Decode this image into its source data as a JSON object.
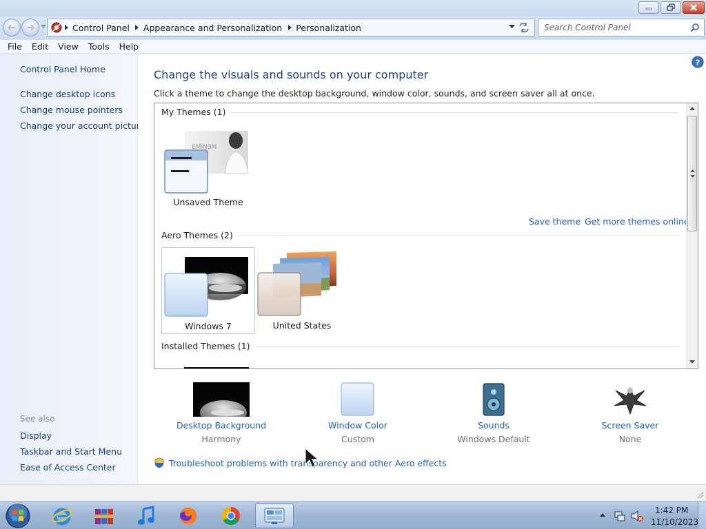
{
  "address": {
    "crumbs": [
      "Control Panel",
      "Appearance and Personalization",
      "Personalization"
    ]
  },
  "search": {
    "placeholder": "Search Control Panel"
  },
  "menu": [
    "File",
    "Edit",
    "View",
    "Tools",
    "Help"
  ],
  "sidebar": {
    "home": "Control Panel Home",
    "links": [
      "Change desktop icons",
      "Change mouse pointers",
      "Change your account picture"
    ],
    "see_also_title": "See also",
    "see_also": [
      "Display",
      "Taskbar and Start Menu",
      "Ease of Access Center"
    ]
  },
  "main": {
    "heading": "Change the visuals and sounds on your computer",
    "subtext": "Click a theme to change the desktop background, window color, sounds, and screen saver all at once.",
    "sections": {
      "my_themes": "My Themes (1)",
      "aero_themes": "Aero Themes (2)",
      "installed_themes": "Installed Themes (1)"
    },
    "themes": {
      "unsaved": "Unsaved Theme",
      "windows7": "Windows 7",
      "united_states": "United States",
      "unsaved_wallpaper_text": "EMINƎM"
    },
    "links": {
      "save_theme": "Save theme",
      "get_more": "Get more themes online"
    },
    "bottom": [
      {
        "label": "Desktop Background",
        "value": "Harmony"
      },
      {
        "label": "Window Color",
        "value": "Custom"
      },
      {
        "label": "Sounds",
        "value": "Windows Default"
      },
      {
        "label": "Screen Saver",
        "value": "None"
      }
    ],
    "troubleshoot": "Troubleshoot problems with transparency and other Aero effects"
  },
  "taskbar": {
    "time": "1:42 PM",
    "date": "11/10/2023"
  },
  "icons": {
    "back": "back-arrow-icon",
    "forward": "forward-arrow-icon",
    "search": "magnifier-icon",
    "help": "question-icon",
    "shield": "uac-shield-icon"
  },
  "colors": {
    "link": "#1e5eb0",
    "heading": "#1e3f8a",
    "close_button": "#c6452c"
  }
}
